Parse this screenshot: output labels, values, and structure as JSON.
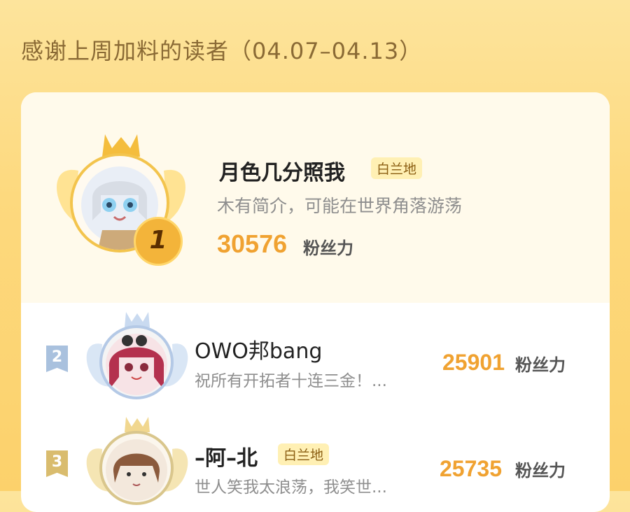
{
  "header": {
    "title": "感谢上周加料的读者（04.07–04.13）"
  },
  "rankings": [
    {
      "rank": "1",
      "name": "月色几分照我",
      "tag": "白兰地",
      "bio": "木有简介，可能在世界角落游荡",
      "fans": "30576",
      "fans_label": "粉丝力"
    },
    {
      "rank": "2",
      "name": "OWO邦bang",
      "tag": "",
      "bio": "祝所有开拓者十连三金！...",
      "fans": "25901",
      "fans_label": "粉丝力"
    },
    {
      "rank": "3",
      "name": "–阿–北",
      "tag": "白兰地",
      "bio": "世人笑我太浪荡，我笑世...",
      "fans": "25735",
      "fans_label": "粉丝力"
    }
  ],
  "colors": {
    "accent": "#f0a231",
    "gold_badge": "#f3b43a",
    "silver_badge": "#a9c1de",
    "bronze_badge": "#d9bc6e"
  },
  "icons": [
    "crown-icon",
    "wings-icon"
  ]
}
